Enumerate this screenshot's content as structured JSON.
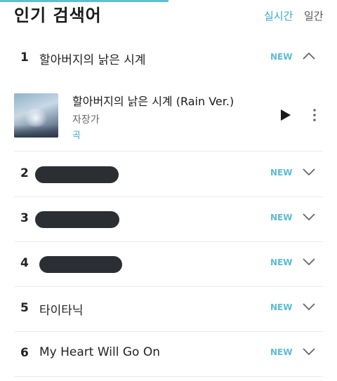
{
  "header": {
    "title": "인기 검색어",
    "tabs": [
      "실시간",
      "일간"
    ],
    "active_tab": "실시간"
  },
  "rows": [
    {
      "rank": "1",
      "keyword": "할아버지의 낡은 시계",
      "badge": "NEW",
      "state": "expanded"
    },
    {
      "rank": "2",
      "keyword": "",
      "redacted": true,
      "badge": "NEW",
      "state": "collapsed"
    },
    {
      "rank": "3",
      "keyword": "",
      "redacted": true,
      "badge": "NEW",
      "state": "collapsed"
    },
    {
      "rank": "4",
      "keyword": "",
      "redacted": true,
      "badge": "NEW",
      "state": "collapsed"
    },
    {
      "rank": "5",
      "keyword": "타이타닉",
      "badge": "NEW",
      "state": "collapsed"
    },
    {
      "rank": "6",
      "keyword": "My Heart Will Go On",
      "badge": "NEW",
      "state": "collapsed"
    }
  ],
  "expanded_item": {
    "title": "할아버지의 낡은 시계 (Rain Ver.)",
    "artist": "자장가",
    "type": "곡",
    "icons": {
      "play": "play-icon",
      "more": "more-vertical-icon"
    }
  },
  "colors": {
    "accent": "#3aa7c5",
    "badge": "#5bbcd6",
    "redaction": "#2b2e33",
    "divider": "#ececec"
  }
}
